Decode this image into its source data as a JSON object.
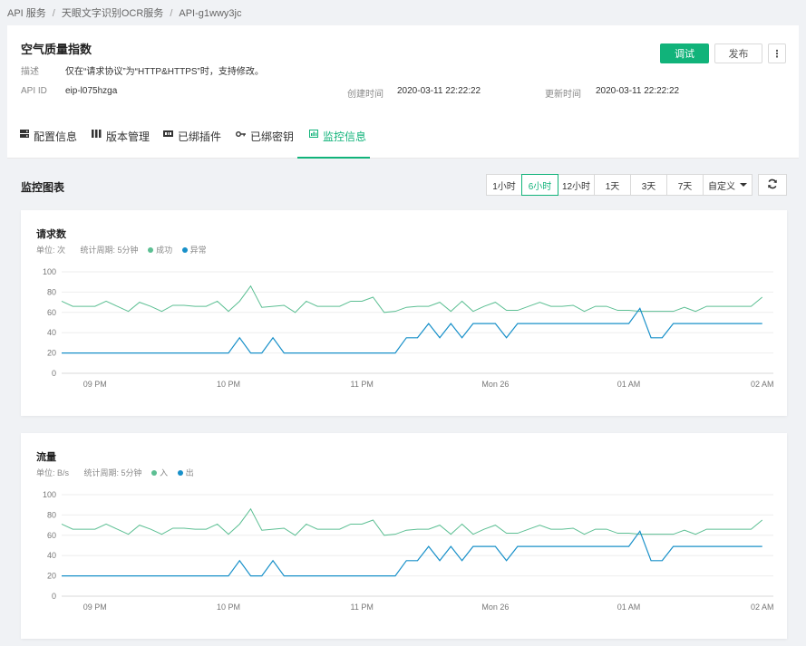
{
  "breadcrumb": [
    "API 服务",
    "天眼文字识别OCR服务",
    "API-g1wwy3jc"
  ],
  "header": {
    "title": "空气质量指数",
    "desc_label": "描述",
    "desc_value": "仅在“请求协议”为“HTTP&HTTPS”时，支持修改。",
    "api_id_label": "API ID",
    "api_id_value": "eip-l075hzga",
    "created_label": "创建时间",
    "created_value": "2020-03-11 22:22:22",
    "updated_label": "更新时间",
    "updated_value": "2020-03-11 22:22:22",
    "debug_label": "调试",
    "publish_label": "发布",
    "more_label": "⋮"
  },
  "tabs": [
    {
      "label": "配置信息",
      "icon": "server-icon",
      "active": false
    },
    {
      "label": "版本管理",
      "icon": "version-icon",
      "active": false
    },
    {
      "label": "已绑插件",
      "icon": "plugin-icon",
      "active": false
    },
    {
      "label": "已绑密钥",
      "icon": "key-icon",
      "active": false
    },
    {
      "label": "监控信息",
      "icon": "monitor-icon",
      "active": true
    }
  ],
  "monitor": {
    "title": "监控图表",
    "ranges": [
      {
        "label": "1小时",
        "active": false
      },
      {
        "label": "6小时",
        "active": true
      },
      {
        "label": "12小时",
        "active": false
      },
      {
        "label": "1天",
        "active": false
      },
      {
        "label": "3天",
        "active": false
      },
      {
        "label": "7天",
        "active": false
      }
    ],
    "custom_label": "自定义"
  },
  "colors": {
    "accent": "#11b37a",
    "series_a": "#5cbf93",
    "series_b": "#1890c9"
  },
  "chart_data": [
    {
      "type": "line",
      "title": "请求数",
      "unit_text": "单位:  次",
      "period_text": "统计周期:  5分钟",
      "ylim": [
        0,
        100
      ],
      "yticks": [
        0,
        20,
        40,
        60,
        80,
        100
      ],
      "xticks": [
        {
          "x": 3,
          "label": "09 PM"
        },
        {
          "x": 15,
          "label": "10 PM"
        },
        {
          "x": 27,
          "label": "11 PM"
        },
        {
          "x": 39,
          "label": "Mon 26"
        },
        {
          "x": 51,
          "label": "01 AM"
        },
        {
          "x": 63,
          "label": "02 AM"
        }
      ],
      "xmax": 64,
      "grid": true,
      "series": [
        {
          "name": "成功",
          "color": "#5cbf93",
          "values": [
            71,
            66,
            66,
            66,
            71,
            66,
            61,
            70,
            66,
            61,
            67,
            67,
            66,
            66,
            71,
            61,
            71,
            86,
            65,
            66,
            67,
            60,
            71,
            66,
            66,
            66,
            71,
            71,
            75,
            60,
            61,
            65,
            66,
            66,
            70,
            61,
            71,
            61,
            66,
            70,
            62,
            62,
            66,
            70,
            66,
            66,
            67,
            61,
            66,
            66,
            62,
            62,
            61,
            61,
            61,
            61,
            65,
            61,
            66,
            66,
            66,
            66,
            66,
            75
          ]
        },
        {
          "name": "异常",
          "color": "#1890c9",
          "values": [
            20,
            20,
            20,
            20,
            20,
            20,
            20,
            20,
            20,
            20,
            20,
            20,
            20,
            20,
            20,
            20,
            35,
            20,
            20,
            35,
            20,
            20,
            20,
            20,
            20,
            20,
            20,
            20,
            20,
            20,
            20,
            35,
            35,
            49,
            35,
            49,
            35,
            49,
            49,
            49,
            35,
            49,
            49,
            49,
            49,
            49,
            49,
            49,
            49,
            49,
            49,
            49,
            64,
            35,
            35,
            49,
            49,
            49,
            49,
            49,
            49,
            49,
            49,
            49
          ]
        }
      ]
    },
    {
      "type": "line",
      "title": "流量",
      "unit_text": "单位:  B/s",
      "period_text": "统计周期:  5分钟",
      "ylim": [
        0,
        100
      ],
      "yticks": [
        0,
        20,
        40,
        60,
        80,
        100
      ],
      "xticks": [
        {
          "x": 3,
          "label": "09 PM"
        },
        {
          "x": 15,
          "label": "10 PM"
        },
        {
          "x": 27,
          "label": "11 PM"
        },
        {
          "x": 39,
          "label": "Mon 26"
        },
        {
          "x": 51,
          "label": "01 AM"
        },
        {
          "x": 63,
          "label": "02 AM"
        }
      ],
      "xmax": 64,
      "grid": true,
      "series": [
        {
          "name": "入",
          "color": "#5cbf93",
          "values": [
            71,
            66,
            66,
            66,
            71,
            66,
            61,
            70,
            66,
            61,
            67,
            67,
            66,
            66,
            71,
            61,
            71,
            86,
            65,
            66,
            67,
            60,
            71,
            66,
            66,
            66,
            71,
            71,
            75,
            60,
            61,
            65,
            66,
            66,
            70,
            61,
            71,
            61,
            66,
            70,
            62,
            62,
            66,
            70,
            66,
            66,
            67,
            61,
            66,
            66,
            62,
            62,
            61,
            61,
            61,
            61,
            65,
            61,
            66,
            66,
            66,
            66,
            66,
            75
          ]
        },
        {
          "name": "出",
          "color": "#1890c9",
          "values": [
            20,
            20,
            20,
            20,
            20,
            20,
            20,
            20,
            20,
            20,
            20,
            20,
            20,
            20,
            20,
            20,
            35,
            20,
            20,
            35,
            20,
            20,
            20,
            20,
            20,
            20,
            20,
            20,
            20,
            20,
            20,
            35,
            35,
            49,
            35,
            49,
            35,
            49,
            49,
            49,
            35,
            49,
            49,
            49,
            49,
            49,
            49,
            49,
            49,
            49,
            49,
            49,
            64,
            35,
            35,
            49,
            49,
            49,
            49,
            49,
            49,
            49,
            49,
            49
          ]
        }
      ]
    }
  ]
}
